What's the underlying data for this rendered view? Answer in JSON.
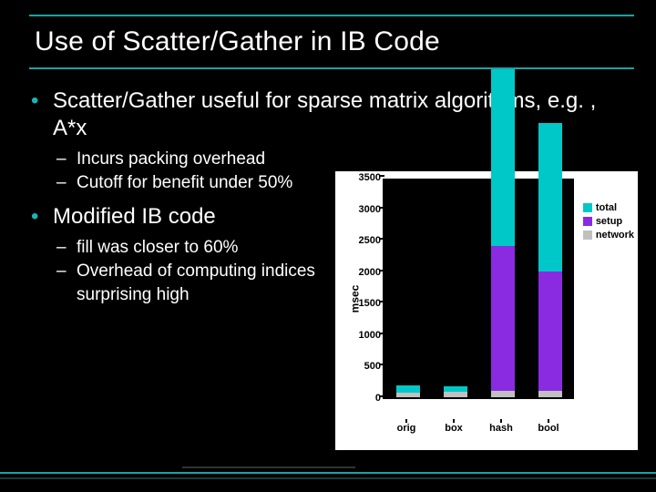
{
  "title": "Use of Scatter/Gather in IB Code",
  "bullets": {
    "b1": "Scatter/Gather useful for sparse matrix algorithms, e.g. , A*x",
    "b1a": "Incurs packing overhead",
    "b1b": "Cutoff for benefit under 50%",
    "b2": "Modified IB code",
    "b2a": "fill was closer to 60%",
    "b2b": "Overhead of computing indices surprising high"
  },
  "legend": {
    "total": "total",
    "setup": "setup",
    "network": "network"
  },
  "chart_data": {
    "type": "bar",
    "ylabel": "msec",
    "categories": [
      "orig",
      "box",
      "hash",
      "bool"
    ],
    "ylim": [
      0,
      3500
    ],
    "yticks": [
      0,
      500,
      1000,
      1500,
      2000,
      2500,
      3000,
      3500
    ],
    "series": [
      {
        "name": "total",
        "values": [
          120,
          100,
          2800,
          2350
        ]
      },
      {
        "name": "setup",
        "values": [
          0,
          0,
          2300,
          1900
        ]
      },
      {
        "name": "network",
        "values": [
          70,
          80,
          100,
          100
        ]
      }
    ]
  }
}
